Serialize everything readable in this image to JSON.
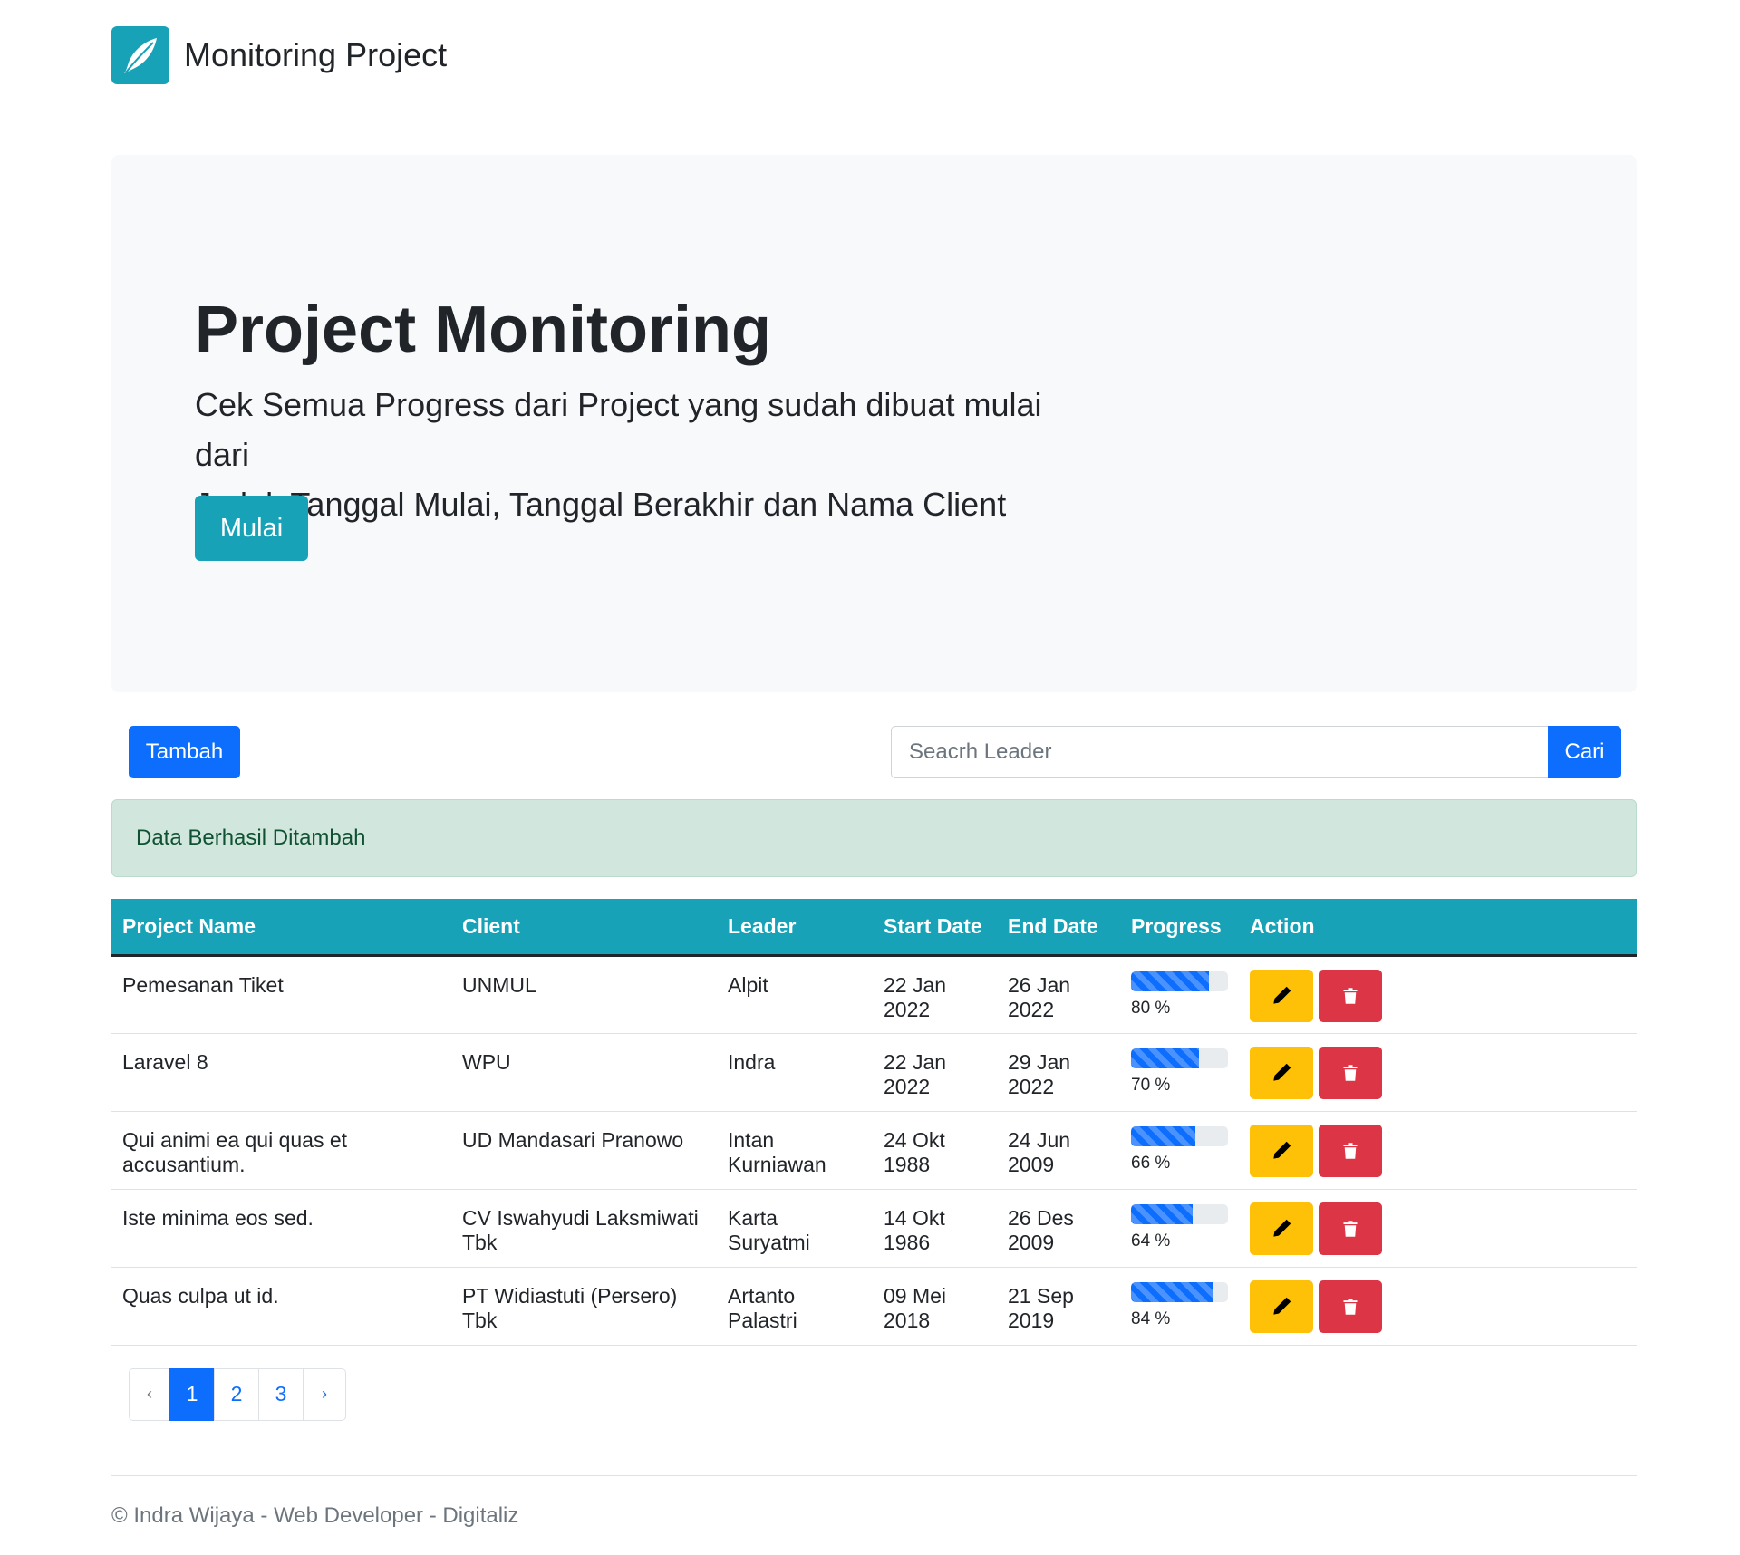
{
  "header": {
    "brand": "Monitoring Project",
    "logo_icon": "feather-icon"
  },
  "hero": {
    "title": "Project Monitoring",
    "lead_line1": "Cek Semua Progress dari Project yang sudah dibuat mulai dari",
    "lead_line2": "Judul, Tanggal Mulai, Tanggal Berakhir dan Nama Client",
    "button": "Mulai"
  },
  "toolbar": {
    "add_button": "Tambah",
    "search_placeholder": "Seacrh Leader",
    "search_value": "",
    "search_button": "Cari"
  },
  "alert": {
    "message": "Data Berhasil Ditambah"
  },
  "table": {
    "headers": [
      "Project Name",
      "Client",
      "Leader",
      "Start Date",
      "End Date",
      "Progress",
      "Action"
    ],
    "rows": [
      {
        "project": "Pemesanan Tiket",
        "client": "UNMUL",
        "leader": "Alpit",
        "start": "22 Jan 2022",
        "end": "26 Jan 2022",
        "progress": 80,
        "progress_text": "80 %"
      },
      {
        "project": "Laravel 8",
        "client": "WPU",
        "leader": "Indra",
        "start": "22 Jan 2022",
        "end": "29 Jan 2022",
        "progress": 70,
        "progress_text": "70 %"
      },
      {
        "project": "Qui animi ea qui quas et accusantium.",
        "client": "UD Mandasari Pranowo",
        "leader": "Intan Kurniawan",
        "start": "24 Okt 1988",
        "end": "24 Jun 2009",
        "progress": 66,
        "progress_text": "66 %"
      },
      {
        "project": "Iste minima eos sed.",
        "client": "CV Iswahyudi Laksmiwati Tbk",
        "leader": "Karta Suryatmi",
        "start": "14 Okt 1986",
        "end": "26 Des 2009",
        "progress": 64,
        "progress_text": "64 %"
      },
      {
        "project": "Quas culpa ut id.",
        "client": "PT Widiastuti (Persero) Tbk",
        "leader": "Artanto Palastri",
        "start": "09 Mei 2018",
        "end": "21 Sep 2019",
        "progress": 84,
        "progress_text": "84 %"
      }
    ],
    "edit_icon": "pencil-icon",
    "delete_icon": "trash-icon"
  },
  "pagination": {
    "prev": "‹",
    "pages": [
      "1",
      "2",
      "3"
    ],
    "active": "1",
    "next": "›"
  },
  "footer": {
    "text": "© Indra Wijaya - Web Developer - Digitaliz"
  },
  "colors": {
    "primary": "#0d6efd",
    "info": "#17a2b8",
    "warning": "#ffc107",
    "danger": "#dc3545",
    "success_bg": "#d1e7dd"
  }
}
